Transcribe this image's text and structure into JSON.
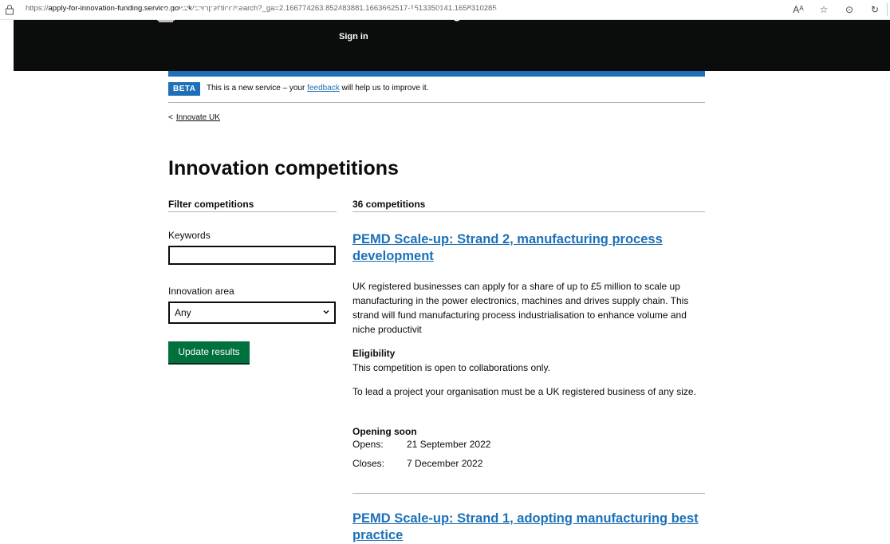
{
  "browser": {
    "url_prefix": "https://",
    "url_domain": "apply-for-innovation-funding.service.gov.uk",
    "url_path": "/competition/search?_ga=2.166774263.852483881.1663662517-1513350141.1658310285"
  },
  "header": {
    "logo_text": "GOV.UK",
    "service_name": "Innovation Funding Service",
    "sign_in": "Sign in"
  },
  "phase_banner": {
    "tag": "BETA",
    "text_before": "This is a new service – your ",
    "link": "feedback",
    "text_after": " will help us to improve it."
  },
  "breadcrumb": {
    "back_chevron": "<",
    "label": "Innovate UK"
  },
  "page_title": "Innovation competitions",
  "filter": {
    "heading": "Filter competitions",
    "keywords_label": "Keywords",
    "keywords_value": "",
    "area_label": "Innovation area",
    "area_selected": "Any",
    "update_button": "Update results"
  },
  "results": {
    "count_heading": "36 competitions",
    "competitions": [
      {
        "title": "PEMD Scale-up: Strand 2, manufacturing process development",
        "description": "UK registered businesses can apply for a share of up to £5 million to scale up manufacturing in the power electronics, machines and drives supply chain. This strand will fund manufacturing process industrialisation to enhance volume and niche productivit",
        "eligibility_heading": "Eligibility",
        "eligibility_1": "This competition is open to collaborations only.",
        "eligibility_2": "To lead a project your organisation must be a UK registered business of any size.",
        "status": "Opening soon",
        "opens_label": "Opens:",
        "opens_value": "21 September 2022",
        "closes_label": "Closes:",
        "closes_value": "7 December 2022"
      },
      {
        "title": "PEMD Scale-up: Strand 1, adopting manufacturing best practice"
      }
    ]
  },
  "colors": {
    "header_bg": "#0b0c0c",
    "link": "#1d70b8",
    "button": "#00703c"
  }
}
